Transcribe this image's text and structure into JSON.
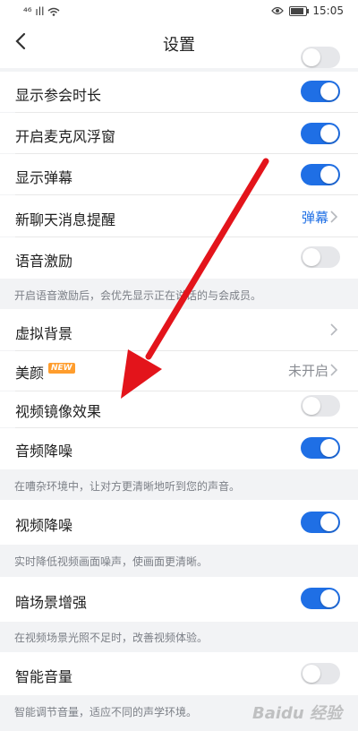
{
  "status": {
    "left": "⁴⁶ ıll",
    "time": "15:05"
  },
  "nav": {
    "title": "设置"
  },
  "rows": [
    {
      "label": "显示参会时长",
      "toggle": "on"
    },
    {
      "label": "开启麦克风浮窗",
      "toggle": "on"
    },
    {
      "label": "显示弹幕",
      "toggle": "on"
    },
    {
      "label": "新聊天消息提醒",
      "value": "弹幕"
    },
    {
      "label": "语音激励",
      "toggle": "off"
    },
    {
      "label": "虚拟背景"
    },
    {
      "label": "美颜",
      "badge": "NEW",
      "value": "未开启"
    },
    {
      "label": "视频镜像效果",
      "toggle": "off"
    },
    {
      "label": "音频降噪",
      "toggle": "on"
    },
    {
      "label": "视频降噪",
      "toggle": "on"
    },
    {
      "label": "暗场景增强",
      "toggle": "on"
    },
    {
      "label": "智能音量",
      "toggle": "off"
    }
  ],
  "notes": [
    "开启语音激励后，会优先显示正在说话的与会成员。",
    "在嘈杂环境中，让对方更清晰地听到您的声音。",
    "实时降低视频画面噪声，使画面更清晰。",
    "在视频场景光照不足时，改善视频体验。",
    "智能调节音量，适应不同的声学环境。"
  ],
  "colors": {
    "accent": "#1f6fe5",
    "arrow": "#e3141b"
  },
  "watermark": "Baidu 经验"
}
